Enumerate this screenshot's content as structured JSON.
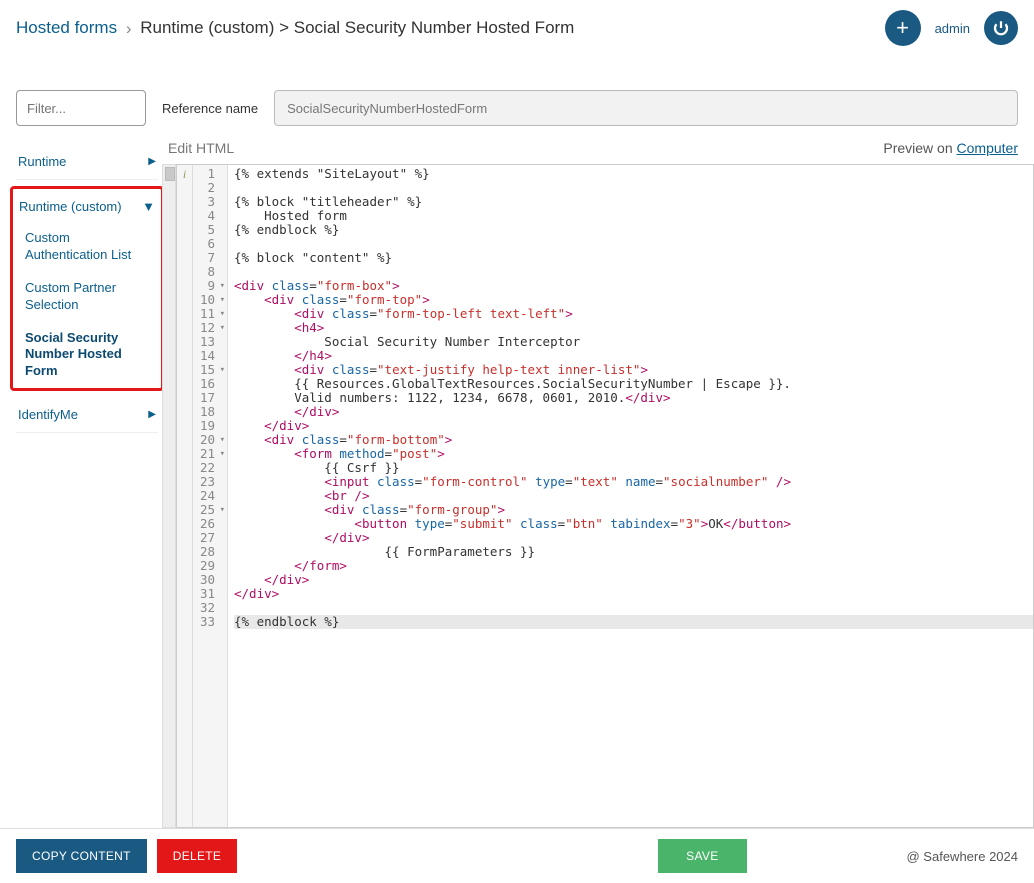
{
  "header": {
    "breadcrumb_root": "Hosted forms",
    "breadcrumb_rest": "Runtime (custom) > Social Security Number Hosted Form",
    "user_label": "admin"
  },
  "meta": {
    "filter_placeholder": "Filter...",
    "reference_label": "Reference name",
    "reference_value": "SocialSecurityNumberHostedForm"
  },
  "sidebar": {
    "runtime_label": "Runtime",
    "runtime_custom_label": "Runtime (custom)",
    "sub1": "Custom Authentication List",
    "sub2": "Custom Partner Selection",
    "sub3": "Social Security Number Hosted Form",
    "identifyme_label": "IdentifyMe"
  },
  "editor": {
    "title": "Edit HTML",
    "preview_prefix": "Preview on ",
    "preview_target": "Computer",
    "info_letter": "i",
    "lines": [
      {
        "n": 1,
        "fold": "",
        "html": "{% extends \"SiteLayout\" %}",
        "cls": ""
      },
      {
        "n": 2,
        "fold": "",
        "html": "",
        "cls": ""
      },
      {
        "n": 3,
        "fold": "",
        "html": "{% block \"titleheader\" %}",
        "cls": ""
      },
      {
        "n": 4,
        "fold": "",
        "html": "    Hosted form",
        "cls": ""
      },
      {
        "n": 5,
        "fold": "",
        "html": "{% endblock %}",
        "cls": ""
      },
      {
        "n": 6,
        "fold": "",
        "html": "",
        "cls": ""
      },
      {
        "n": 7,
        "fold": "",
        "html": "{% block \"content\" %}",
        "cls": ""
      },
      {
        "n": 8,
        "fold": "",
        "html": "",
        "cls": ""
      },
      {
        "n": 9,
        "fold": "▾",
        "html": "<span class='t-tag'>&lt;div</span> <span class='t-attr'>class</span>=<span class='t-str'>\"form-box\"</span><span class='t-tag'>&gt;</span>",
        "cls": ""
      },
      {
        "n": 10,
        "fold": "▾",
        "html": "    <span class='t-tag'>&lt;div</span> <span class='t-attr'>class</span>=<span class='t-str'>\"form-top\"</span><span class='t-tag'>&gt;</span>",
        "cls": ""
      },
      {
        "n": 11,
        "fold": "▾",
        "html": "        <span class='t-tag'>&lt;div</span> <span class='t-attr'>class</span>=<span class='t-str'>\"form-top-left text-left\"</span><span class='t-tag'>&gt;</span>",
        "cls": ""
      },
      {
        "n": 12,
        "fold": "▾",
        "html": "        <span class='t-tag'>&lt;h4&gt;</span>",
        "cls": ""
      },
      {
        "n": 13,
        "fold": "",
        "html": "            Social Security Number Interceptor",
        "cls": ""
      },
      {
        "n": 14,
        "fold": "",
        "html": "        <span class='t-tag'>&lt;/h4&gt;</span>",
        "cls": ""
      },
      {
        "n": 15,
        "fold": "▾",
        "html": "        <span class='t-tag'>&lt;div</span> <span class='t-attr'>class</span>=<span class='t-str'>\"text-justify help-text inner-list\"</span><span class='t-tag'>&gt;</span>",
        "cls": ""
      },
      {
        "n": 16,
        "fold": "",
        "html": "        {{ Resources.GlobalTextResources.SocialSecurityNumber | Escape }}.",
        "cls": ""
      },
      {
        "n": 17,
        "fold": "",
        "html": "        Valid numbers: 1122, 1234, 6678, 0601, 2010.<span class='t-tag'>&lt;/div&gt;</span>",
        "cls": ""
      },
      {
        "n": 18,
        "fold": "",
        "html": "        <span class='t-tag'>&lt;/div&gt;</span>",
        "cls": ""
      },
      {
        "n": 19,
        "fold": "",
        "html": "    <span class='t-tag'>&lt;/div&gt;</span>",
        "cls": ""
      },
      {
        "n": 20,
        "fold": "▾",
        "html": "    <span class='t-tag'>&lt;div</span> <span class='t-attr'>class</span>=<span class='t-str'>\"form-bottom\"</span><span class='t-tag'>&gt;</span>",
        "cls": ""
      },
      {
        "n": 21,
        "fold": "▾",
        "html": "        <span class='t-tag'>&lt;form</span> <span class='t-attr'>method</span>=<span class='t-str'>\"post\"</span><span class='t-tag'>&gt;</span>",
        "cls": ""
      },
      {
        "n": 22,
        "fold": "",
        "html": "            {{ Csrf }}",
        "cls": ""
      },
      {
        "n": 23,
        "fold": "",
        "html": "            <span class='t-tag'>&lt;input</span> <span class='t-attr'>class</span>=<span class='t-str'>\"form-control\"</span> <span class='t-attr'>type</span>=<span class='t-str'>\"text\"</span> <span class='t-attr'>name</span>=<span class='t-str'>\"socialnumber\"</span> <span class='t-tag'>/&gt;</span>",
        "cls": ""
      },
      {
        "n": 24,
        "fold": "",
        "html": "            <span class='t-tag'>&lt;br /&gt;</span>",
        "cls": ""
      },
      {
        "n": 25,
        "fold": "▾",
        "html": "            <span class='t-tag'>&lt;div</span> <span class='t-attr'>class</span>=<span class='t-str'>\"form-group\"</span><span class='t-tag'>&gt;</span>",
        "cls": ""
      },
      {
        "n": 26,
        "fold": "",
        "html": "                <span class='t-tag'>&lt;button</span> <span class='t-attr'>type</span>=<span class='t-str'>\"submit\"</span> <span class='t-attr'>class</span>=<span class='t-str'>\"btn\"</span> <span class='t-attr'>tabindex</span>=<span class='t-str'>\"3\"</span><span class='t-tag'>&gt;</span>OK<span class='t-tag'>&lt;/button&gt;</span>",
        "cls": ""
      },
      {
        "n": 27,
        "fold": "",
        "html": "            <span class='t-tag'>&lt;/div&gt;</span>",
        "cls": ""
      },
      {
        "n": 28,
        "fold": "",
        "html": "                    {{ FormParameters }}",
        "cls": ""
      },
      {
        "n": 29,
        "fold": "",
        "html": "        <span class='t-tag'>&lt;/form&gt;</span>",
        "cls": ""
      },
      {
        "n": 30,
        "fold": "",
        "html": "    <span class='t-tag'>&lt;/div&gt;</span>",
        "cls": ""
      },
      {
        "n": 31,
        "fold": "",
        "html": "<span class='t-tag'>&lt;/div&gt;</span>",
        "cls": ""
      },
      {
        "n": 32,
        "fold": "",
        "html": "",
        "cls": ""
      },
      {
        "n": 33,
        "fold": "",
        "html": "{% endblock %}",
        "cls": "hi"
      }
    ]
  },
  "footer": {
    "copy_label": "COPY CONTENT",
    "delete_label": "DELETE",
    "save_label": "SAVE",
    "copyright": "@ Safewhere 2024"
  }
}
